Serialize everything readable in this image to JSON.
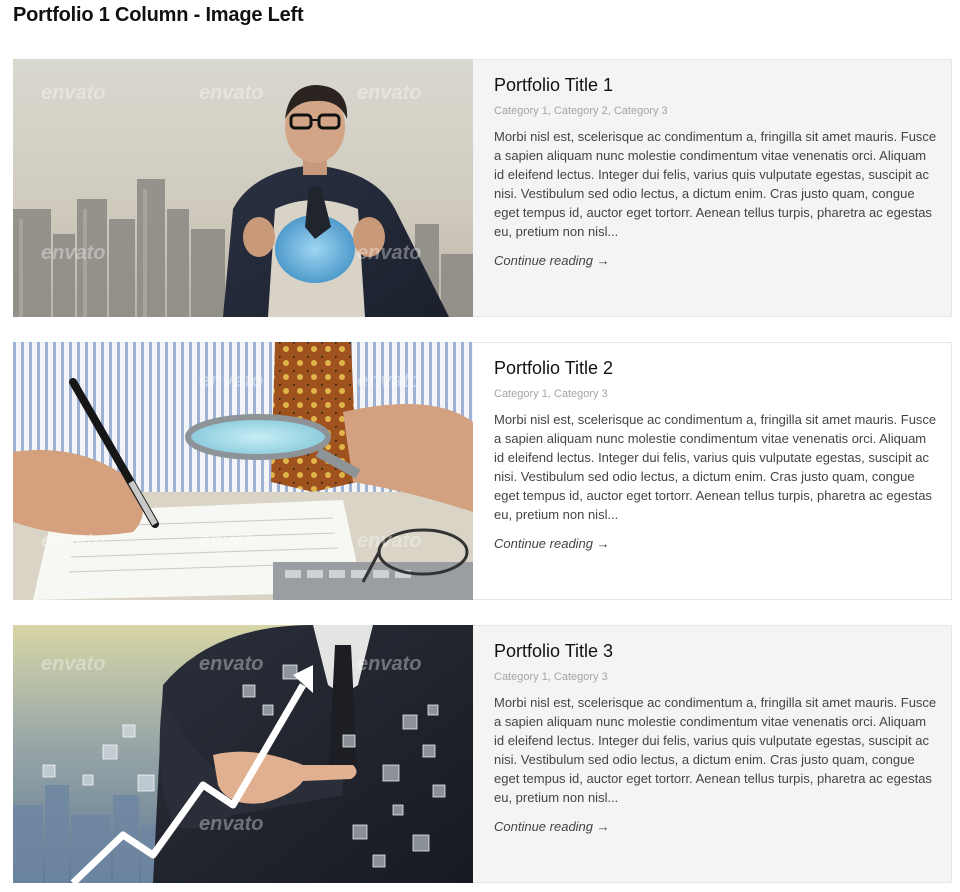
{
  "page_title": "Portfolio 1 Column - Image Left",
  "items": [
    {
      "title": "Portfolio Title 1",
      "categories": "Category 1, Category 2, Category 3",
      "excerpt": "Morbi nisl est, scelerisque ac condimentum a, fringilla sit amet mauris. Fusce a sapien aliquam nunc molestie condimentum vitae venenatis orci. Aliquam id eleifend lectus. Integer dui felis, varius quis vulputate egestas, suscipit ac nisi. Vestibulum sed odio lectus, a dictum enim. Cras justo quam, congue eget tempus id, auctor eget tortorr. Aenean tellus turpis, pharetra ac egestas eu, pretium non nisl...",
      "link_label": "Continue reading →",
      "image_subject": "businessman opening shirt with blue superhero emblem, city skyline",
      "watermark": "envato"
    },
    {
      "title": "Portfolio Title 2",
      "categories": "Category 1, Category 3",
      "excerpt": "Morbi nisl est, scelerisque ac condimentum a, fringilla sit amet mauris. Fusce a sapien aliquam nunc molestie condimentum vitae venenatis orci. Aliquam id eleifend lectus. Integer dui felis, varius quis vulputate egestas, suscipit ac nisi. Vestibulum sed odio lectus, a dictum enim. Cras justo quam, congue eget tempus id, auctor eget tortorr. Aenean tellus turpis, pharetra ac egestas eu, pretium non nisl...",
      "link_label": "Continue reading →",
      "image_subject": "hands with pen and magnifying glass over documents and calculator",
      "watermark": "envato"
    },
    {
      "title": "Portfolio Title 3",
      "categories": "Category 1, Category 3",
      "excerpt": "Morbi nisl est, scelerisque ac condimentum a, fringilla sit amet mauris. Fusce a sapien aliquam nunc molestie condimentum vitae venenatis orci. Aliquam id eleifend lectus. Integer dui felis, varius quis vulputate egestas, suscipit ac nisi. Vestibulum sed odio lectus, a dictum enim. Cras justo quam, congue eget tempus id, auctor eget tortorr. Aenean tellus turpis, pharetra ac egestas eu, pretium non nisl...",
      "link_label": "Continue reading →",
      "image_subject": "businessman pointing at rising arrow graph with floating squares over city",
      "watermark": "envato"
    }
  ]
}
